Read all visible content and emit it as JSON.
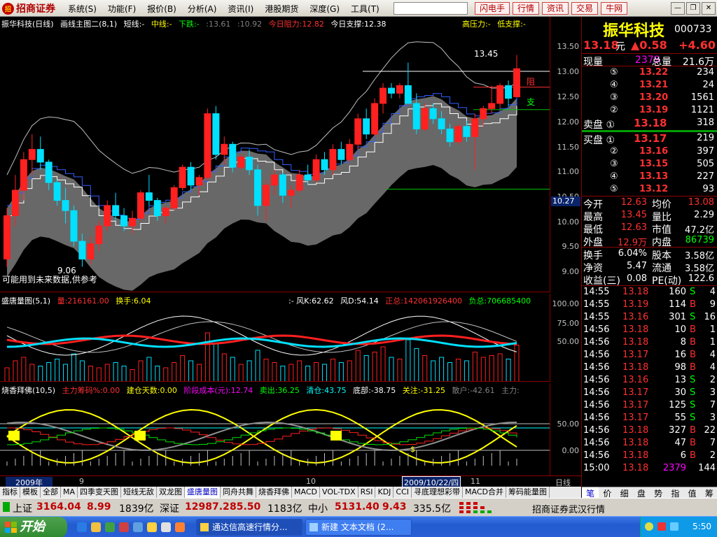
{
  "app": {
    "logo": "招商证券",
    "menu": [
      "系统(S)",
      "功能(F)",
      "报价(B)",
      "分析(A)",
      "资讯(I)",
      "港股期货",
      "深度(G)",
      "工具(T)"
    ],
    "quick_buttons": [
      "闪电手",
      "行情",
      "资讯",
      "交易",
      "牛网"
    ]
  },
  "main_chart": {
    "header": {
      "name": "振华科技(日线)",
      "template": "画线主图二(8,1)",
      "short": "短线:-",
      "mid": "中线:-",
      "down": "下跌:-",
      "v1": ":13.61",
      "v2": ":10.92",
      "resistance": "今日阻力:12.82",
      "support": "今日支撑:12.38",
      "high_pressure": "高压力:-",
      "low_support": "低支撑:-"
    },
    "price_axis": [
      "13.50",
      "13.00",
      "12.50",
      "12.00",
      "11.50",
      "11.00",
      "10.50",
      "10.00",
      "9.50",
      "9.00"
    ],
    "price_marker": "10.27",
    "hi_label": "13.45",
    "lo_label": "9.06",
    "resist_label": "阻",
    "support_label": "支",
    "note": "可能用到未来数据,供参考"
  },
  "vol_chart": {
    "header": {
      "name": "盛唐量图(5,1)",
      "vol": "量:216161.00",
      "turn": "换手:6.04",
      "fk": ":-  风K:62.62",
      "fd": "风D:54.14",
      "pos": "正总:142061926400",
      "neg": "负总:706685400"
    },
    "axis": [
      "100.00",
      "75.00",
      "50.00"
    ]
  },
  "bb_chart": {
    "header": {
      "name": "烧香拜佛(10,5)",
      "chip": "主力筹码%:0.00",
      "days": "建仓天数:0.00",
      "cost": "阶段成本(元):12.74",
      "sell": "卖出:36.25",
      "clear": "清仓:43.75",
      "bottom": "底部:-38.75",
      "watch": "关注:-31.25",
      "retail": "散户:-42.61",
      "main": "主力:"
    },
    "axis": [
      "50.00",
      "0.00"
    ],
    "dollar_label": "$"
  },
  "chart_data": {
    "type": "candlestick",
    "ylim": [
      8.8,
      13.65
    ],
    "ohlc": [
      [
        9.45,
        10.45,
        9.3,
        10.3
      ],
      [
        10.3,
        11.1,
        10.1,
        10.8
      ],
      [
        10.8,
        11.55,
        10.6,
        11.4
      ],
      [
        11.4,
        11.9,
        11.1,
        11.6
      ],
      [
        11.6,
        11.85,
        11.2,
        11.35
      ],
      [
        11.35,
        11.4,
        10.8,
        10.95
      ],
      [
        10.95,
        11.0,
        10.5,
        10.6
      ],
      [
        10.6,
        10.85,
        10.15,
        10.4
      ],
      [
        10.4,
        10.5,
        9.7,
        9.8
      ],
      [
        9.8,
        9.95,
        9.3,
        9.45
      ],
      [
        9.45,
        9.9,
        9.35,
        9.75
      ],
      [
        9.75,
        10.2,
        9.6,
        10.1
      ],
      [
        10.1,
        10.6,
        10.0,
        10.5
      ],
      [
        10.5,
        10.75,
        10.2,
        10.3
      ],
      [
        10.3,
        10.45,
        10.0,
        10.1
      ],
      [
        10.1,
        10.4,
        9.95,
        10.25
      ],
      [
        10.25,
        10.8,
        10.2,
        10.75
      ],
      [
        10.75,
        11.1,
        10.5,
        10.6
      ],
      [
        10.6,
        10.65,
        10.2,
        10.3
      ],
      [
        10.3,
        10.5,
        10.15,
        10.45
      ],
      [
        10.45,
        10.9,
        10.4,
        10.85
      ],
      [
        10.85,
        11.3,
        10.8,
        11.25
      ],
      [
        11.25,
        11.35,
        10.8,
        10.9
      ],
      [
        10.9,
        11.1,
        10.7,
        11.05
      ],
      [
        11.05,
        12.4,
        11.0,
        12.3
      ],
      [
        12.3,
        12.45,
        11.4,
        11.5
      ],
      [
        11.5,
        11.85,
        11.3,
        11.7
      ],
      [
        11.7,
        11.75,
        11.15,
        11.25
      ],
      [
        11.25,
        11.5,
        11.2,
        11.45
      ],
      [
        11.45,
        11.6,
        11.1,
        11.2
      ],
      [
        11.2,
        11.3,
        10.3,
        10.5
      ],
      [
        10.5,
        11.0,
        10.2,
        10.9
      ],
      [
        10.9,
        11.2,
        10.7,
        11.1
      ],
      [
        11.1,
        11.15,
        10.55,
        10.7
      ],
      [
        10.7,
        10.9,
        10.45,
        10.8
      ],
      [
        10.8,
        11.2,
        10.75,
        11.1
      ],
      [
        11.1,
        11.3,
        10.9,
        11.0
      ],
      [
        11.0,
        11.5,
        10.95,
        11.4
      ],
      [
        11.4,
        11.55,
        11.1,
        11.2
      ],
      [
        11.2,
        11.7,
        11.1,
        11.6
      ],
      [
        11.6,
        11.75,
        11.3,
        11.4
      ],
      [
        11.4,
        11.8,
        11.35,
        11.7
      ],
      [
        11.7,
        12.3,
        11.6,
        12.2
      ],
      [
        12.2,
        12.4,
        11.8,
        11.9
      ],
      [
        11.9,
        12.6,
        11.85,
        12.5
      ],
      [
        12.5,
        12.9,
        12.3,
        12.8
      ],
      [
        12.8,
        12.9,
        12.6,
        12.7
      ],
      [
        12.7,
        12.9,
        12.6,
        12.85
      ],
      [
        12.85,
        13.3,
        12.7,
        12.5
      ],
      [
        12.5,
        12.7,
        11.9,
        12.0
      ],
      [
        12.0,
        12.5,
        11.95,
        12.4
      ],
      [
        12.4,
        12.5,
        12.1,
        12.2
      ],
      [
        12.2,
        12.35,
        11.9,
        12.0
      ],
      [
        12.0,
        12.1,
        11.65,
        11.75
      ],
      [
        11.75,
        12.1,
        11.7,
        12.05
      ],
      [
        12.05,
        12.15,
        11.75,
        11.85
      ],
      [
        11.85,
        12.3,
        11.2,
        12.2
      ],
      [
        12.2,
        12.45,
        12.05,
        12.4
      ],
      [
        12.4,
        12.85,
        12.3,
        12.5
      ],
      [
        12.5,
        12.9,
        12.4,
        12.85
      ],
      [
        12.85,
        12.95,
        12.45,
        12.6
      ],
      [
        12.63,
        13.45,
        12.63,
        13.18
      ]
    ],
    "volume": [
      8,
      12,
      14,
      10,
      9,
      11,
      13,
      10,
      16,
      12,
      9,
      8,
      10,
      11,
      9,
      7,
      12,
      14,
      9,
      8,
      11,
      15,
      12,
      10,
      28,
      22,
      16,
      14,
      10,
      12,
      18,
      13,
      11,
      9,
      10,
      12,
      9,
      11,
      10,
      13,
      11,
      12,
      18,
      15,
      17,
      20,
      14,
      13,
      24,
      19,
      15,
      12,
      14,
      11,
      13,
      12,
      17,
      14,
      15,
      16,
      13,
      21
    ]
  },
  "quote": {
    "name": "振华科技",
    "code": "000733",
    "price": "13.18",
    "unit": "元",
    "change": "▲0.58",
    "pct": "+4.60",
    "vol_label": "现量",
    "vol_value": "2379",
    "total_label": "总量",
    "total_value": "21.6万",
    "sells": [
      {
        "lvl": "⑤",
        "price": "13.22",
        "vol": "234"
      },
      {
        "lvl": "④",
        "price": "13.21",
        "vol": "24"
      },
      {
        "lvl": "③",
        "price": "13.20",
        "vol": "1561"
      },
      {
        "lvl": "②",
        "price": "13.19",
        "vol": "1121"
      },
      {
        "lvl": "卖盘 ①",
        "price": "13.18",
        "vol": "318"
      }
    ],
    "buys": [
      {
        "lvl": "买盘 ①",
        "price": "13.17",
        "vol": "219"
      },
      {
        "lvl": "②",
        "price": "13.16",
        "vol": "397"
      },
      {
        "lvl": "③",
        "price": "13.15",
        "vol": "505"
      },
      {
        "lvl": "④",
        "price": "13.13",
        "vol": "227"
      },
      {
        "lvl": "⑤",
        "price": "13.12",
        "vol": "93"
      }
    ],
    "stats": [
      {
        "l1": "今开",
        "v1": "12.63",
        "l2": "均价",
        "v2": "13.08"
      },
      {
        "l1": "最高",
        "v1": "13.45",
        "l2": "量比",
        "v2": "2.29"
      },
      {
        "l1": "最低",
        "v1": "12.63",
        "l2": "市值",
        "v2": "47.2亿"
      },
      {
        "l1": "外盘",
        "v1": "12.9万",
        "l2": "内盘",
        "v2": "86739"
      }
    ],
    "stats2": [
      {
        "l1": "换手",
        "v1": "6.04%",
        "l2": "股本",
        "v2": "3.58亿"
      },
      {
        "l1": "净资",
        "v1": "5.47",
        "l2": "流通",
        "v2": "3.58亿"
      },
      {
        "l1": "收益(三)",
        "v1": "0.08",
        "l2": "PE(动)",
        "v2": "122.6"
      }
    ]
  },
  "ticks": [
    {
      "time": "14:55",
      "price": "13.18",
      "vol": "160",
      "side": "S",
      "n": "4"
    },
    {
      "time": "14:55",
      "price": "13.19",
      "vol": "114",
      "side": "B",
      "n": "9"
    },
    {
      "time": "14:55",
      "price": "13.16",
      "vol": "301",
      "side": "S",
      "n": "16"
    },
    {
      "time": "14:56",
      "price": "13.18",
      "vol": "10",
      "side": "B",
      "n": "1"
    },
    {
      "time": "14:56",
      "price": "13.18",
      "vol": "8",
      "side": "B",
      "n": "1"
    },
    {
      "time": "14:56",
      "price": "13.17",
      "vol": "16",
      "side": "B",
      "n": "4"
    },
    {
      "time": "14:56",
      "price": "13.18",
      "vol": "98",
      "side": "B",
      "n": "4"
    },
    {
      "time": "14:56",
      "price": "13.16",
      "vol": "13",
      "side": "S",
      "n": "2"
    },
    {
      "time": "14:56",
      "price": "13.17",
      "vol": "30",
      "side": "S",
      "n": "3"
    },
    {
      "time": "14:56",
      "price": "13.17",
      "vol": "125",
      "side": "S",
      "n": "7"
    },
    {
      "time": "14:56",
      "price": "13.17",
      "vol": "55",
      "side": "S",
      "n": "3"
    },
    {
      "time": "14:56",
      "price": "13.18",
      "vol": "327",
      "side": "B",
      "n": "22"
    },
    {
      "time": "14:56",
      "price": "13.18",
      "vol": "47",
      "side": "B",
      "n": "7"
    },
    {
      "time": "14:56",
      "price": "13.18",
      "vol": "6",
      "side": "B",
      "n": "2"
    },
    {
      "time": "15:00",
      "price": "13.18",
      "vol": "2379",
      "side": "",
      "n": "144"
    }
  ],
  "right_tabs": [
    "笔",
    "价",
    "细",
    "盘",
    "势",
    "指",
    "值",
    "筹"
  ],
  "tabs": [
    "指标",
    "模板",
    "全部",
    "MA",
    "四季变天图",
    "短线无敌",
    "双龙图",
    "盛唐量图",
    "同舟共舞",
    "烧香拜佛",
    "MACD",
    "VOL-TDX",
    "RSI",
    "KDJ",
    "CCI",
    "寻底理想彩带",
    "MACD合并",
    "筹码能量图"
  ],
  "active_tab": "盛唐量图",
  "datebar": {
    "y2009": "2009年",
    "m9": "9",
    "m10": "10",
    "sel": "2009/10/22/四",
    "m11": "11",
    "period": "日线"
  },
  "indices": [
    {
      "name": "上证",
      "v": "3164.04",
      "c": "8.99",
      "a": "1839亿"
    },
    {
      "name": "深证",
      "v": "12987.2",
      "c": "85.50",
      "a": "1183亿"
    },
    {
      "name": "中小",
      "v": "5131.40",
      "c": "9.43",
      "a": "335.5亿"
    }
  ],
  "broker_status": "招商证券武汉行情",
  "taskbar": {
    "start": "开始",
    "task1": "通达信高速行情分...",
    "task2": "新建 文本文档 (2...",
    "clock": "5:50"
  }
}
